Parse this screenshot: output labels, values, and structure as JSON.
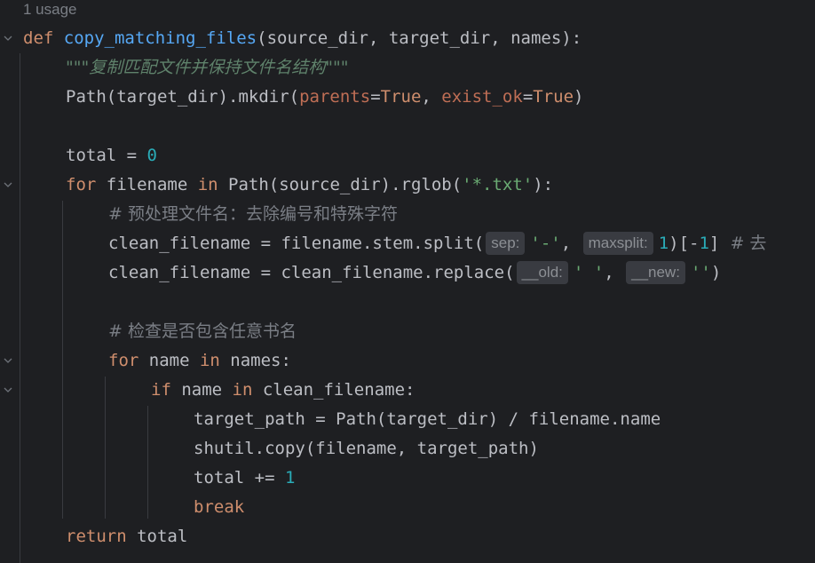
{
  "usage_label": "1 usage",
  "code": {
    "l1": {
      "def": "def",
      "name": "copy_matching_files",
      "params": "(source_dir, target_dir, names):"
    },
    "l2": {
      "docstring": "\"\"\"复制匹配文件并保持文件名结构\"\"\""
    },
    "l3": {
      "pre": "Path(target_dir).mkdir(",
      "p1": "parents",
      "eq1": "=",
      "v1": "True",
      "sep": ", ",
      "p2": "exist_ok",
      "eq2": "=",
      "v2": "True",
      "post": ")"
    },
    "l5": {
      "pre": "total = ",
      "num": "0"
    },
    "l6": {
      "for": "for",
      "mid": " filename ",
      "in": "in",
      "post": " Path(source_dir).rglob(",
      "str": "'*.txt'",
      "end": "):"
    },
    "l7": {
      "comment": "# 预处理文件名：去除编号和特殊字符"
    },
    "l8": {
      "pre": "clean_filename = filename.stem.split(",
      "hint1": "sep:",
      "str1": "'-'",
      "sep": ", ",
      "hint2": "maxsplit:",
      "num1": "1",
      "mid": ")[-",
      "num2": "1",
      "end": "]",
      "comment": "  # 去"
    },
    "l9": {
      "pre": "clean_filename = clean_filename.replace(",
      "hint1": "__old:",
      "str1": "' '",
      "sep": ", ",
      "hint2": "__new:",
      "str2": "''",
      "end": ")"
    },
    "l11": {
      "comment": "# 检查是否包含任意书名"
    },
    "l12": {
      "for": "for",
      "mid": " name ",
      "in": "in",
      "post": " names:"
    },
    "l13": {
      "if": "if",
      "mid": " name ",
      "in": "in",
      "post": " clean_filename:"
    },
    "l14": {
      "text": "target_path = Path(target_dir) / filename.name"
    },
    "l15": {
      "text": "shutil.copy(filename, target_path)"
    },
    "l16": {
      "pre": "total += ",
      "num": "1"
    },
    "l17": {
      "kw": "break"
    },
    "l18": {
      "kw": "return",
      "post": " total"
    }
  },
  "colors": {
    "background": "#1e1f22",
    "keyword": "#cf8e6d",
    "function": "#56a8f5",
    "number": "#2aacb8",
    "string": "#6aab73",
    "docstring": "#5f826b",
    "comment": "#7a7e85",
    "named_param": "#bf6e55",
    "inlay_hint_bg": "#393b41"
  },
  "icons": [
    "fold-chevron-icon"
  ]
}
